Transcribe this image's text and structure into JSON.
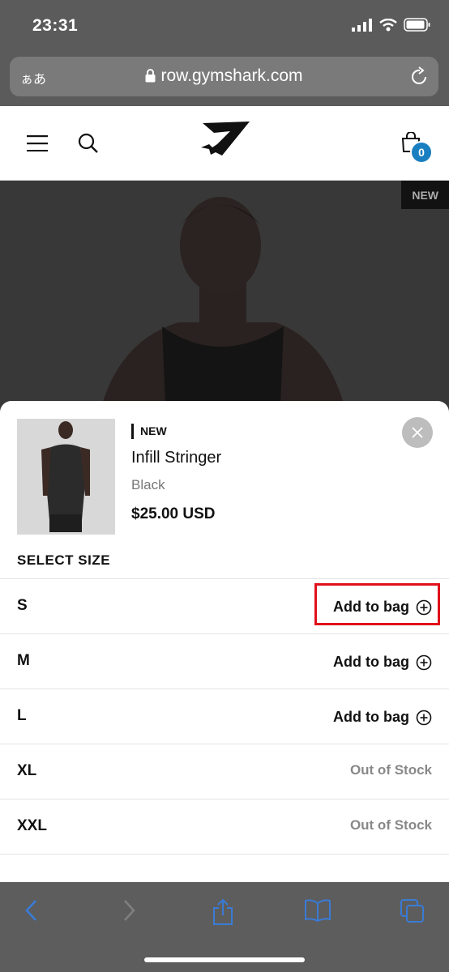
{
  "status": {
    "time": "23:31"
  },
  "browser": {
    "aa": "ぁあ",
    "url": "row.gymshark.com"
  },
  "header": {
    "bag_count": "0"
  },
  "hero": {
    "badge": "NEW"
  },
  "product": {
    "badge": "NEW",
    "name": "Infill Stringer",
    "color": "Black",
    "price": "$25.00 USD"
  },
  "size_section": {
    "title": "SELECT SIZE",
    "sizes": [
      {
        "label": "S",
        "action": "Add to bag"
      },
      {
        "label": "M",
        "action": "Add to bag"
      },
      {
        "label": "L",
        "action": "Add to bag"
      },
      {
        "label": "XL",
        "status": "Out of Stock"
      },
      {
        "label": "XXL",
        "status": "Out of Stock"
      }
    ]
  },
  "colors": {
    "accent": "#1a7fc1",
    "toolbar_icon": "#3a7bd5",
    "highlight": "#e0101a"
  },
  "icons": [
    "menu-icon",
    "search-icon",
    "bag-icon",
    "close-icon",
    "plus-circle-icon",
    "back-icon",
    "forward-icon",
    "share-icon",
    "bookmarks-icon",
    "tabs-icon"
  ]
}
